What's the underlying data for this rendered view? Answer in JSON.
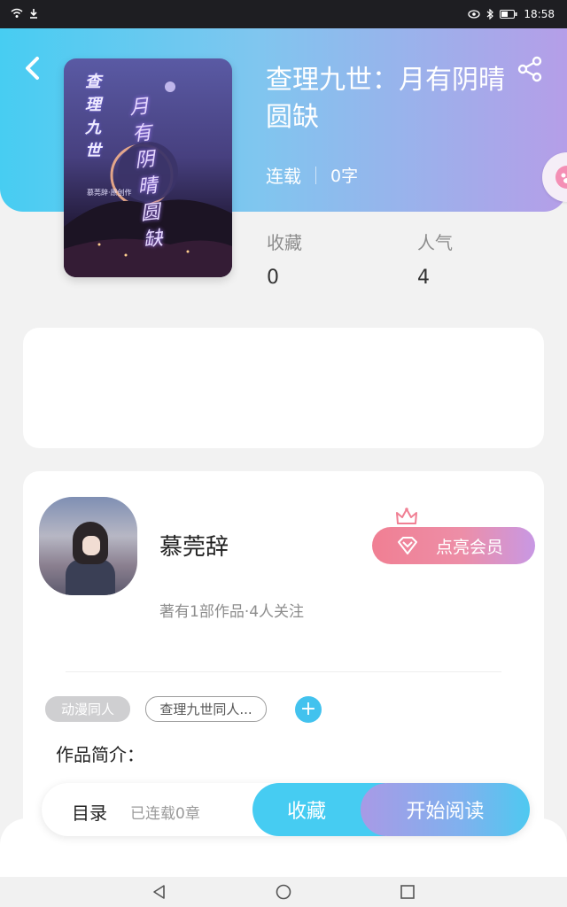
{
  "status_bar": {
    "time": "18:58",
    "icons": [
      "wifi-icon",
      "download-icon",
      "eye-icon",
      "bluetooth-icon",
      "battery-icon"
    ]
  },
  "header": {
    "back_icon": "chevron-left-icon",
    "share_icon": "share-icon"
  },
  "book": {
    "title": "查理九世：月有阴晴圆缺",
    "cover": {
      "title_left": "查理九世",
      "title_right": "月有阴晴圆缺",
      "author_line": "慕莞辞·原创作"
    },
    "status": "连载",
    "word_count": "0字",
    "stats": [
      {
        "label": "收藏",
        "value": "0"
      },
      {
        "label": "人气",
        "value": "4"
      }
    ]
  },
  "author": {
    "name": "慕莞辞",
    "meta": "著有1部作品·4人关注",
    "vip_button": "点亮会员"
  },
  "tags": [
    "动漫同人",
    "查理九世同人..."
  ],
  "intro_label": "作品简介：",
  "action_bar": {
    "toc_label": "目录",
    "toc_sub": "已连载0章",
    "favorite_label": "收藏",
    "read_label": "开始阅读"
  },
  "colors": {
    "header_gradient_start": "#47cdf2",
    "header_gradient_end": "#b59ee8",
    "accent_blue": "#46ccf2",
    "vip_pink": "#f07f93"
  }
}
